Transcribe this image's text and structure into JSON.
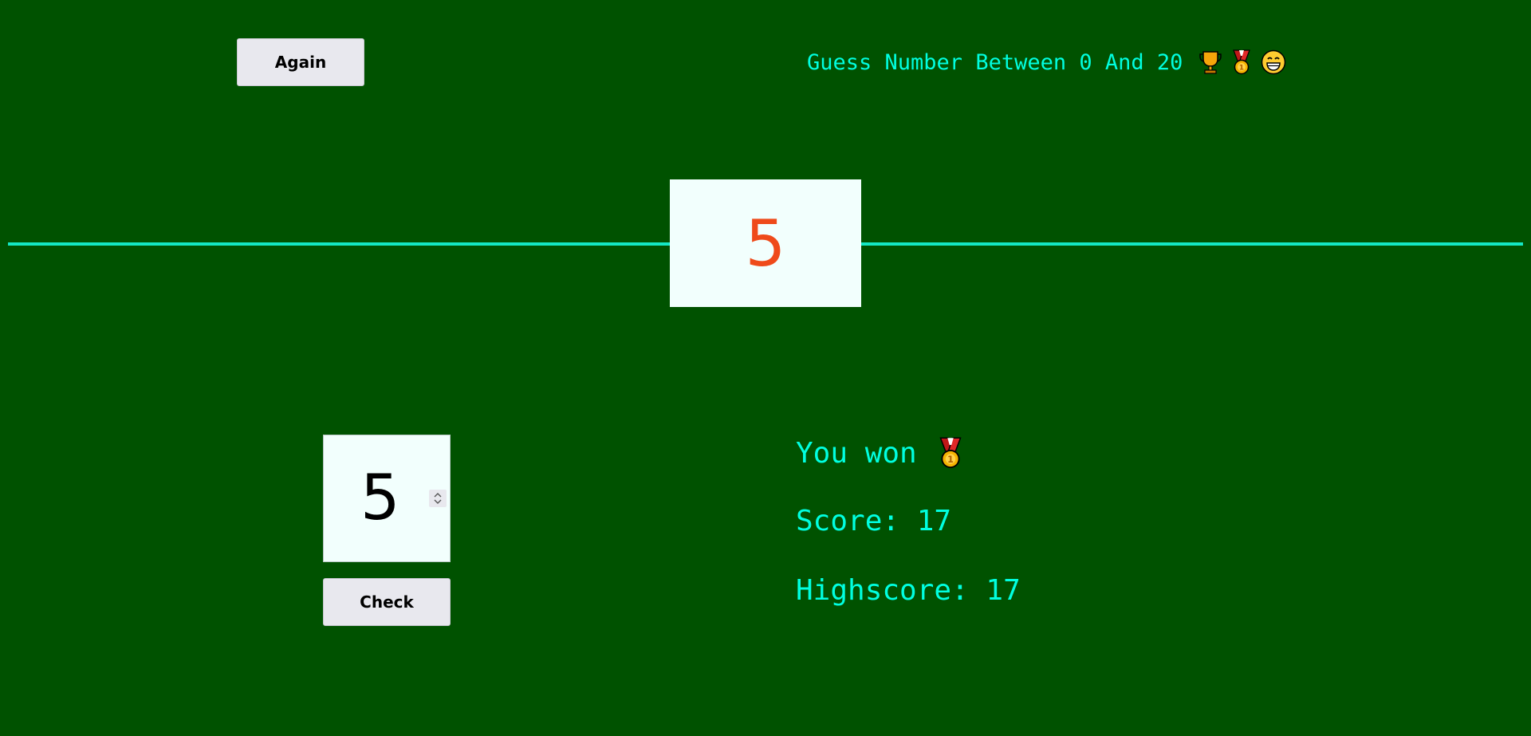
{
  "header": {
    "again_label": "Again",
    "title": "Guess Number Between 0 And 20",
    "title_icons": [
      "trophy-icon",
      "medal-icon",
      "grinning-face-icon"
    ]
  },
  "secret": {
    "number": "5"
  },
  "guess": {
    "value": "5",
    "check_label": "Check"
  },
  "status": {
    "message": "You won",
    "message_icon": "medal-icon",
    "score_text": "Score: 17",
    "highscore_text": "Highscore: 17"
  },
  "colors": {
    "background": "#005200",
    "accent_text": "#00ffe0",
    "divider": "#14e8c4",
    "secret_number": "#ef4a1a",
    "box_background": "#f2fffd",
    "button_background": "#e8e8ee"
  }
}
